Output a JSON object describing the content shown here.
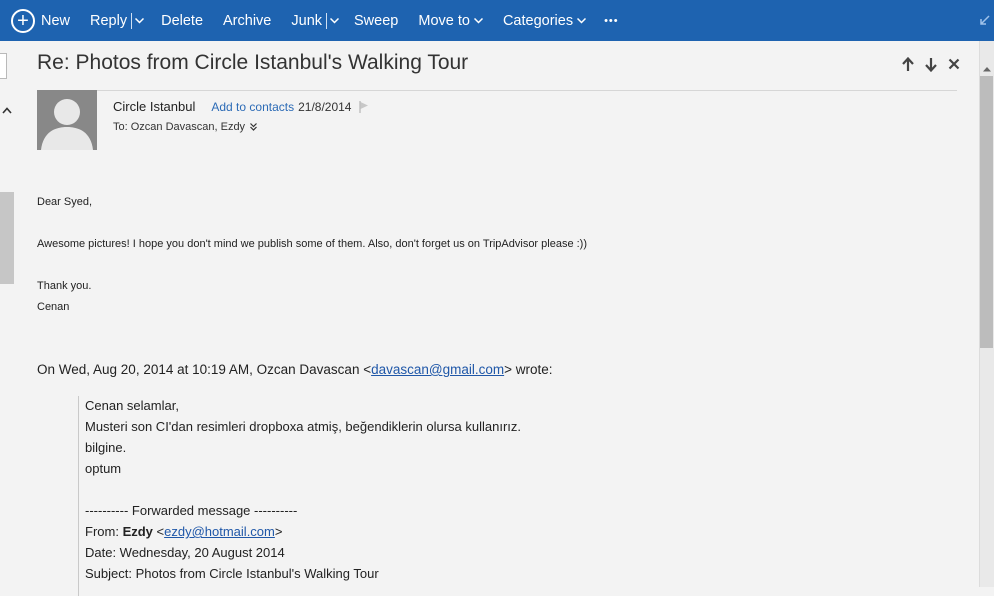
{
  "toolbar": {
    "new": "New",
    "reply": "Reply",
    "delete": "Delete",
    "archive": "Archive",
    "junk": "Junk",
    "sweep": "Sweep",
    "move_to": "Move to",
    "categories": "Categories",
    "more": "•••",
    "icons": [
      "plus-circle-icon",
      "chevron-down-icon",
      "more-icon",
      "collapse-icon"
    ]
  },
  "message": {
    "subject": "Re: Photos from Circle Istanbul's Walking Tour",
    "sender_name": "Circle Istanbul",
    "add_contacts": "Add to contacts",
    "date": "21/8/2014",
    "to_line": "To: Ozcan Davascan, Ezdy",
    "body": {
      "greeting": "Dear Syed,",
      "line1": "Awesome pictures! I hope you don't mind we publish some of them. Also, don't forget us on TripAdvisor please :))",
      "thanks": "Thank you.",
      "signature": "Cenan"
    },
    "quote": {
      "intro_prefix": "On Wed, Aug 20, 2014 at 10:19 AM, Ozcan Davascan <",
      "intro_email": "davascan@gmail.com",
      "intro_suffix": "> wrote:",
      "lines": [
        "Cenan selamlar,",
        "Musteri son CI'dan resimleri dropboxa atmiş, beğendiklerin olursa kullanırız.",
        "bilgine.",
        "optum"
      ],
      "forwarded": "---------- Forwarded message ----------",
      "from_label": "From: ",
      "from_name": "Ezdy",
      "from_open": " <",
      "from_email": "ezdy@hotmail.com",
      "from_close": ">",
      "date_line": "Date: Wednesday, 20 August 2014",
      "subject_line": "Subject: Photos from Circle Istanbul's Walking Tour"
    }
  },
  "colors": {
    "toolbar": "#1e63b0",
    "link": "#2c6bb6",
    "background": "#f3f3f3"
  }
}
